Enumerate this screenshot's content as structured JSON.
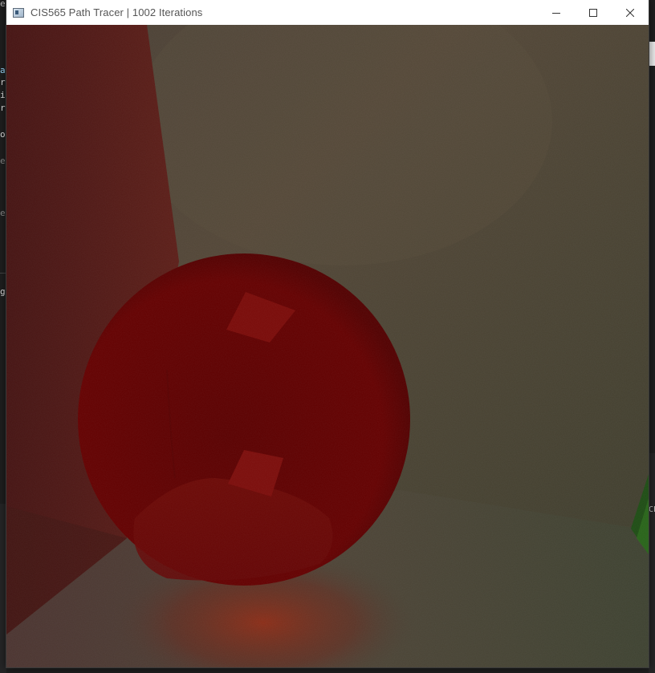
{
  "window": {
    "title": "CIS565 Path Tracer | 1002 Iterations",
    "icon": "app-window-icon",
    "controls": {
      "minimize": "minimize-icon",
      "maximize": "maximize-icon",
      "close": "close-icon"
    }
  },
  "background_editor": {
    "visible_fragments": [
      "e",
      "a",
      "r",
      "i",
      "r",
      "o",
      "e",
      "e",
      "g"
    ],
    "right_fragment": "CF"
  },
  "render": {
    "scene": "cornell-box-with-red-glass-sphere",
    "colors": {
      "left_wall": "#5a1a17",
      "back_wall": "#4f4637",
      "right_wall": "#1f4a15",
      "floor": "#4a4236",
      "sphere": "#600000",
      "glow": "#8a2a14"
    }
  }
}
